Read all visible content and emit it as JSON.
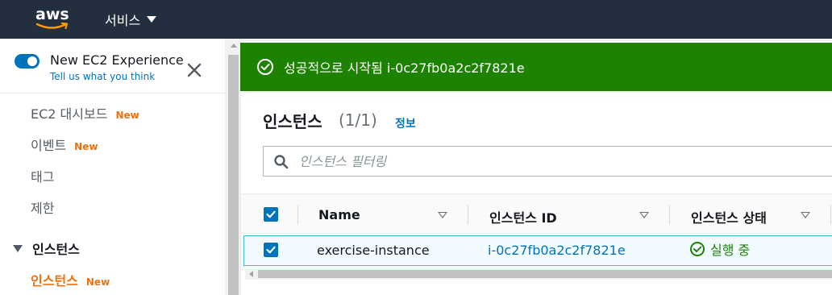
{
  "topnav": {
    "logo_text": "aws",
    "services_label": "서비스"
  },
  "sidebar": {
    "experience_title": "New EC2 Experience",
    "experience_link": "Tell us what you think",
    "toggle_on": true,
    "items": [
      {
        "label": "EC2 대시보드",
        "badge": "New"
      },
      {
        "label": "이벤트",
        "badge": "New"
      },
      {
        "label": "태그",
        "badge": ""
      },
      {
        "label": "제한",
        "badge": ""
      }
    ],
    "section_label": "인스턴스",
    "active_item": {
      "label": "인스턴스",
      "badge": "New"
    }
  },
  "flash": {
    "message": "성공적으로 시작됨 i-0c27fb0a2c2f7821e"
  },
  "panel": {
    "title": "인스턴스",
    "count": "(1/1)",
    "info_link": "정보",
    "search_placeholder": "인스턴스 필터링"
  },
  "table": {
    "columns": [
      "Name",
      "인스턴스 ID",
      "인스턴스 상태"
    ],
    "rows": [
      {
        "selected": true,
        "name": "exercise-instance",
        "instance_id": "i-0c27fb0a2c2f7821e",
        "state": "실행 중"
      }
    ]
  },
  "colors": {
    "nav_bg": "#232f3e",
    "success_green": "#1d8102",
    "link_blue": "#0073bb",
    "new_orange": "#ec7211"
  },
  "icons": {
    "close": "close-icon",
    "success": "check-circle-icon",
    "search": "search-icon",
    "sort": "sort-down-icon"
  }
}
